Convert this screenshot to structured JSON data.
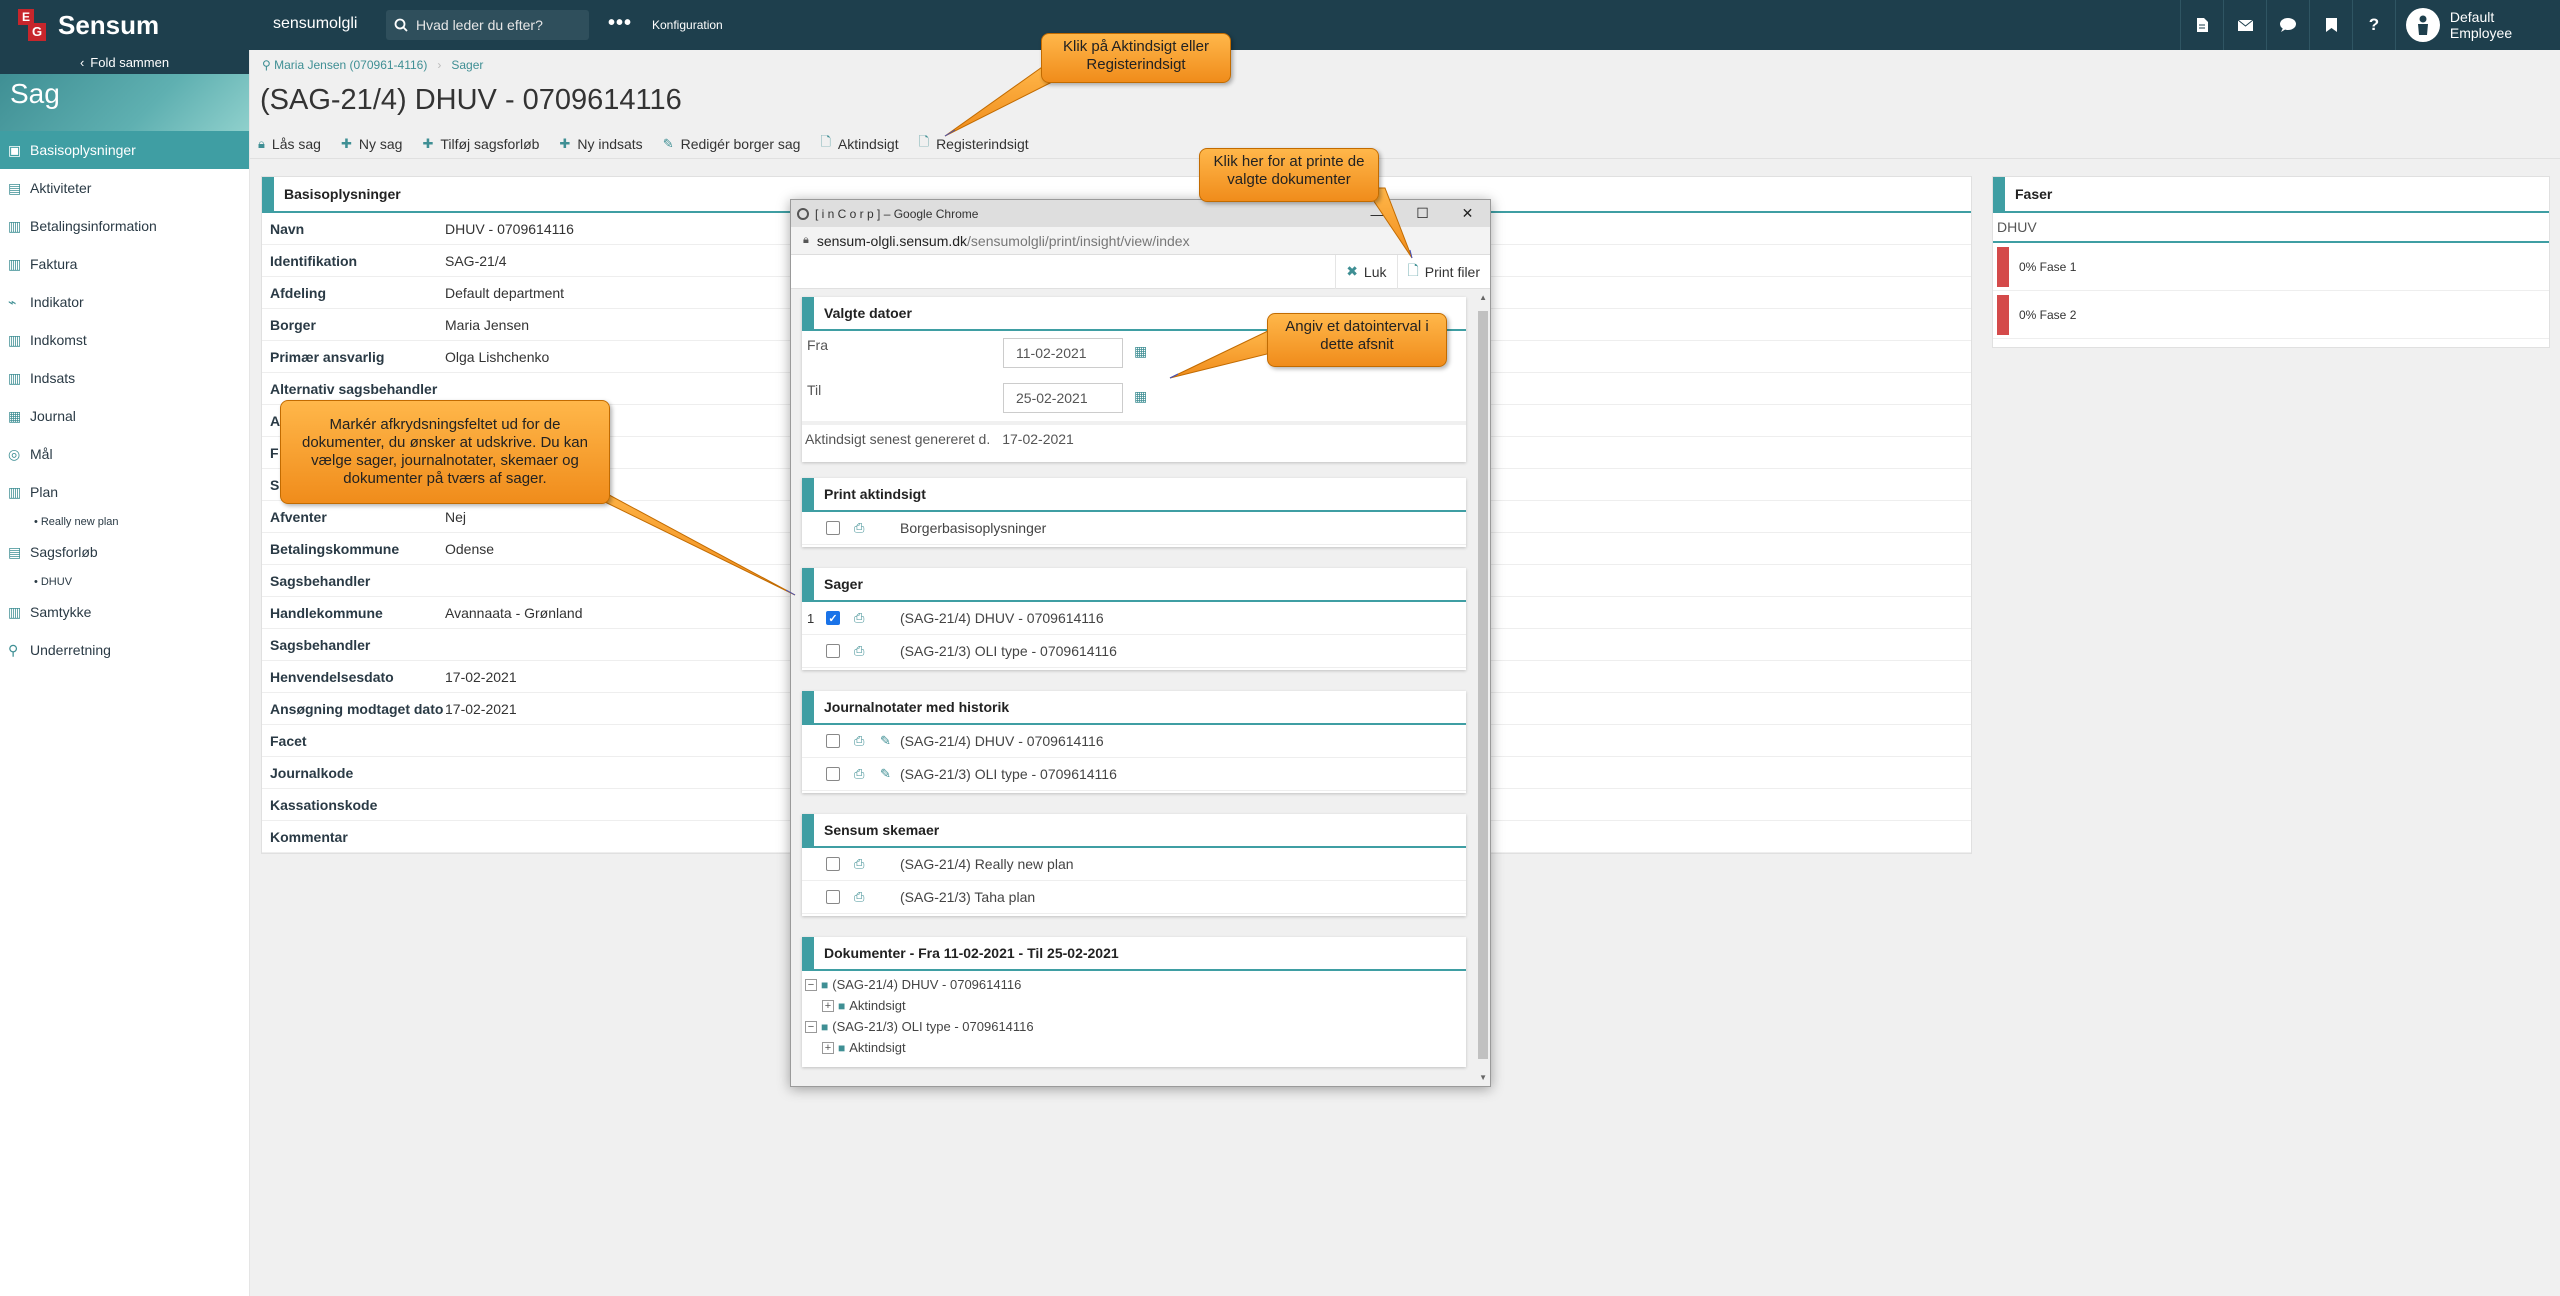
{
  "topbar": {
    "brand_logo_letters": [
      "E",
      "G"
    ],
    "brand_name": "Sensum",
    "tenant": "sensumolgli",
    "search_placeholder": "Hvad leder du efter?",
    "more": "•••",
    "config": "Konfiguration",
    "icons": [
      "document-icon",
      "mail-icon",
      "chat-icon",
      "bookmark-icon",
      "help-icon"
    ],
    "user_name": "Default Employee"
  },
  "sidebar": {
    "fold_label": "Fold sammen",
    "title": "Sag",
    "items": [
      {
        "label": "Basisoplysninger",
        "icon": "id-card-icon"
      },
      {
        "label": "Aktiviteter",
        "icon": "activities-icon"
      },
      {
        "label": "Betalingsinformation",
        "icon": "payment-icon"
      },
      {
        "label": "Faktura",
        "icon": "invoice-icon"
      },
      {
        "label": "Indikator",
        "icon": "chart-icon"
      },
      {
        "label": "Indkomst",
        "icon": "income-icon"
      },
      {
        "label": "Indsats",
        "icon": "effort-icon"
      },
      {
        "label": "Journal",
        "icon": "book-icon"
      },
      {
        "label": "Mål",
        "icon": "target-icon"
      },
      {
        "label": "Plan",
        "icon": "plan-icon"
      },
      {
        "label": "Really new plan",
        "sub": true
      },
      {
        "label": "Sagsforløb",
        "icon": "course-icon"
      },
      {
        "label": "DHUV",
        "sub": true
      },
      {
        "label": "Samtykke",
        "icon": "consent-icon"
      },
      {
        "label": "Underretning",
        "icon": "notification-icon"
      }
    ]
  },
  "breadcrumb": {
    "person": "Maria Jensen (070961-4116)",
    "section": "Sager"
  },
  "page_title": "(SAG-21/4) DHUV - 0709614116",
  "toolbar": [
    {
      "label": "Lås sag",
      "icon": "lock-icon"
    },
    {
      "label": "Ny sag",
      "icon": "plus-icon"
    },
    {
      "label": "Tilføj sagsforløb",
      "icon": "plus-icon"
    },
    {
      "label": "Ny indsats",
      "icon": "plus-icon"
    },
    {
      "label": "Redigér borger sag",
      "icon": "pencil-icon"
    },
    {
      "label": "Aktindsigt",
      "icon": "file-icon"
    },
    {
      "label": "Registerindsigt",
      "icon": "file-icon"
    }
  ],
  "basis": {
    "title": "Basisoplysninger",
    "rows": [
      {
        "label": "Navn",
        "value": "DHUV - 0709614116"
      },
      {
        "label": "Identifikation",
        "value": "SAG-21/4"
      },
      {
        "label": "Afdeling",
        "value": "Default department"
      },
      {
        "label": "Borger",
        "value": "Maria Jensen"
      },
      {
        "label": "Primær ansvarlig",
        "value": "Olga Lishchenko"
      },
      {
        "label": "Alternativ sagsbehandler",
        "value": ""
      },
      {
        "label": "A",
        "value": ""
      },
      {
        "label": "F",
        "value": ""
      },
      {
        "label": "S",
        "value": ""
      },
      {
        "label": "Afventer",
        "value": "Nej"
      },
      {
        "label": "Betalingskommune",
        "value": "Odense"
      },
      {
        "label": "Sagsbehandler",
        "value": ""
      },
      {
        "label": "Handlekommune",
        "value": "Avannaata - Grønland"
      },
      {
        "label": "Sagsbehandler",
        "value": ""
      },
      {
        "label": "Henvendelsesdato",
        "value": "17-02-2021"
      },
      {
        "label": "Ansøgning modtaget dato",
        "value": "17-02-2021"
      },
      {
        "label": "Facet",
        "value": ""
      },
      {
        "label": "Journalkode",
        "value": ""
      },
      {
        "label": "Kassationskode",
        "value": ""
      },
      {
        "label": "Kommentar",
        "value": ""
      }
    ]
  },
  "faser": {
    "title": "Faser",
    "subtitle": "DHUV",
    "rows": [
      {
        "label": "0% Fase 1",
        "color": "#d44a4a"
      },
      {
        "label": "0% Fase 2",
        "color": "#d44a4a"
      }
    ]
  },
  "popup": {
    "window_title": "[ i n C o r p ] – Google Chrome",
    "url_host": "sensum-olgli.sensum.dk",
    "url_path": "/sensumolgli/print/insight/view/index",
    "close_label": "Luk",
    "print_label": "Print filer",
    "dates": {
      "title": "Valgte datoer",
      "from_label": "Fra",
      "from_value": "11-02-2021",
      "to_label": "Til",
      "to_value": "25-02-2021",
      "generated_label": "Aktindsigt senest genereret d.",
      "generated_value": "17-02-2021"
    },
    "print_aktindsigt": {
      "title": "Print aktindsigt",
      "items": [
        {
          "label": "Borgerbasisoplysninger",
          "checked": false
        }
      ]
    },
    "sager": {
      "title": "Sager",
      "count": "1",
      "items": [
        {
          "label": "(SAG-21/4) DHUV - 0709614116",
          "checked": true
        },
        {
          "label": "(SAG-21/3) OLI type - 0709614116",
          "checked": false
        }
      ]
    },
    "journal": {
      "title": "Journalnotater med historik",
      "items": [
        {
          "label": "(SAG-21/4) DHUV - 0709614116",
          "checked": false
        },
        {
          "label": "(SAG-21/3) OLI type - 0709614116",
          "checked": false
        }
      ]
    },
    "skemaer": {
      "title": "Sensum skemaer",
      "items": [
        {
          "label": "(SAG-21/4) Really new plan",
          "checked": false
        },
        {
          "label": "(SAG-21/3) Taha plan",
          "checked": false
        }
      ]
    },
    "dokumenter": {
      "title": "Dokumenter - Fra 11-02-2021 - Til 25-02-2021",
      "tree": [
        {
          "label": "(SAG-21/4) DHUV - 0709614116",
          "child": "Aktindsigt"
        },
        {
          "label": "(SAG-21/3) OLI type - 0709614116",
          "child": "Aktindsigt"
        }
      ]
    }
  },
  "callouts": {
    "aktindsigt": "Klik på Aktindsigt eller Registerindsigt",
    "print": "Klik her for at printe de valgte dokumenter",
    "dato": "Angiv et datointerval i dette afsnit",
    "checkbox": "Markér afkrydsningsfeltet ud for de dokumenter, du ønsker at udskrive. Du kan vælge sager, journalnotater, skemaer og dokumenter på tværs af sager."
  },
  "colors": {
    "topbar": "#1e3f4d",
    "accent": "#3f9ea3",
    "callout": "#f5a030",
    "phase": "#d44a4a"
  }
}
